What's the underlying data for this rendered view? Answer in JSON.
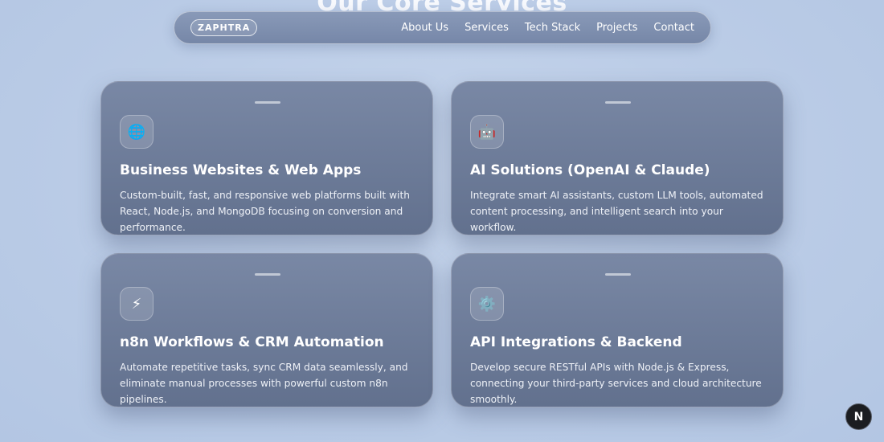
{
  "section": {
    "heading": "Our Core Services"
  },
  "nav": {
    "logo": "ZAPHTRA",
    "links": [
      "About Us",
      "Services",
      "Tech Stack",
      "Projects",
      "Contact"
    ]
  },
  "services": [
    {
      "icon": "globe-icon",
      "glyph": "🌐",
      "title": "Business Websites & Web Apps",
      "description": "Custom-built, fast, and responsive web platforms built with React, Node.js, and MongoDB focusing on conversion and performance."
    },
    {
      "icon": "robot-icon",
      "glyph": "🤖",
      "title": "AI Solutions (OpenAI & Claude)",
      "description": "Integrate smart AI assistants, custom LLM tools, automated content processing, and intelligent search into your workflow."
    },
    {
      "icon": "lightning-icon",
      "glyph": "⚡",
      "title": "n8n Workflows & CRM Automation",
      "description": "Automate repetitive tasks, sync CRM data seamlessly, and eliminate manual processes with powerful custom n8n pipelines."
    },
    {
      "icon": "gear-icon",
      "glyph": "⚙️",
      "title": "API Integrations & Backend",
      "description": "Develop secure RESTful APIs with Node.js & Express, connecting your third-party services and cloud architecture smoothly."
    }
  ],
  "fab": {
    "label": "N",
    "icon": "nextjs-icon"
  }
}
